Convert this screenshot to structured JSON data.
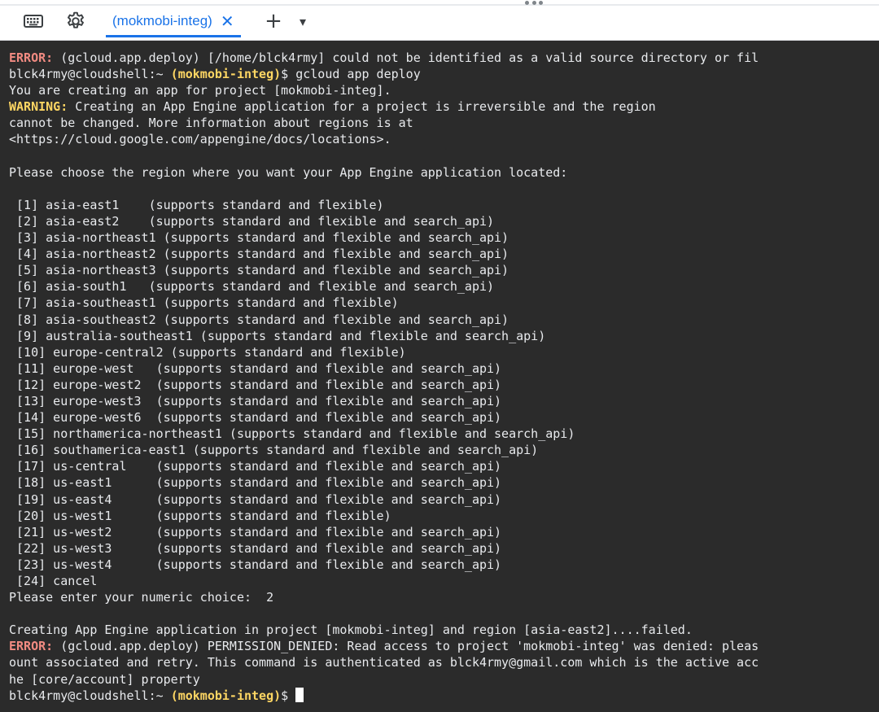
{
  "toolbar": {
    "keyboard_icon": "keyboard-icon",
    "settings_icon": "gear-icon",
    "tab_label": "(mokmobi-integ)",
    "tab_close": "✕",
    "add_tab": "+",
    "more": "▾"
  },
  "colors": {
    "error": "#f28b82",
    "warning": "#fdd663",
    "accent": "#1a73e8",
    "terminal_bg": "#2b2b2b",
    "terminal_fg": "#e8eaed"
  },
  "terminal": {
    "lines": [
      [
        {
          "t": "ERROR:",
          "c": "err"
        },
        {
          "t": " (gcloud.app.deploy) [/home/blck4rmy] could not be identified as a valid source directory or fil"
        }
      ],
      [
        {
          "t": "blck4rmy@cloudshell:~ "
        },
        {
          "t": "(mokmobi-integ)",
          "c": "proj"
        },
        {
          "t": "$ gcloud app deploy"
        }
      ],
      [
        {
          "t": "You are creating an app for project [mokmobi-integ]."
        }
      ],
      [
        {
          "t": "WARNING:",
          "c": "warn"
        },
        {
          "t": " Creating an App Engine application for a project is irreversible and the region"
        }
      ],
      [
        {
          "t": "cannot be changed. More information about regions is at"
        }
      ],
      [
        {
          "t": "<https://cloud.google.com/appengine/docs/locations>."
        }
      ],
      [
        {
          "t": ""
        }
      ],
      [
        {
          "t": "Please choose the region where you want your App Engine application located:"
        }
      ],
      [
        {
          "t": ""
        }
      ],
      [
        {
          "t": " [1] asia-east1    (supports standard and flexible)"
        }
      ],
      [
        {
          "t": " [2] asia-east2    (supports standard and flexible and search_api)"
        }
      ],
      [
        {
          "t": " [3] asia-northeast1 (supports standard and flexible and search_api)"
        }
      ],
      [
        {
          "t": " [4] asia-northeast2 (supports standard and flexible and search_api)"
        }
      ],
      [
        {
          "t": " [5] asia-northeast3 (supports standard and flexible and search_api)"
        }
      ],
      [
        {
          "t": " [6] asia-south1   (supports standard and flexible and search_api)"
        }
      ],
      [
        {
          "t": " [7] asia-southeast1 (supports standard and flexible)"
        }
      ],
      [
        {
          "t": " [8] asia-southeast2 (supports standard and flexible and search_api)"
        }
      ],
      [
        {
          "t": " [9] australia-southeast1 (supports standard and flexible and search_api)"
        }
      ],
      [
        {
          "t": " [10] europe-central2 (supports standard and flexible)"
        }
      ],
      [
        {
          "t": " [11] europe-west   (supports standard and flexible and search_api)"
        }
      ],
      [
        {
          "t": " [12] europe-west2  (supports standard and flexible and search_api)"
        }
      ],
      [
        {
          "t": " [13] europe-west3  (supports standard and flexible and search_api)"
        }
      ],
      [
        {
          "t": " [14] europe-west6  (supports standard and flexible and search_api)"
        }
      ],
      [
        {
          "t": " [15] northamerica-northeast1 (supports standard and flexible and search_api)"
        }
      ],
      [
        {
          "t": " [16] southamerica-east1 (supports standard and flexible and search_api)"
        }
      ],
      [
        {
          "t": " [17] us-central    (supports standard and flexible and search_api)"
        }
      ],
      [
        {
          "t": " [18] us-east1      (supports standard and flexible and search_api)"
        }
      ],
      [
        {
          "t": " [19] us-east4      (supports standard and flexible and search_api)"
        }
      ],
      [
        {
          "t": " [20] us-west1      (supports standard and flexible)"
        }
      ],
      [
        {
          "t": " [21] us-west2      (supports standard and flexible and search_api)"
        }
      ],
      [
        {
          "t": " [22] us-west3      (supports standard and flexible and search_api)"
        }
      ],
      [
        {
          "t": " [23] us-west4      (supports standard and flexible and search_api)"
        }
      ],
      [
        {
          "t": " [24] cancel"
        }
      ],
      [
        {
          "t": "Please enter your numeric choice:  2"
        }
      ],
      [
        {
          "t": ""
        }
      ],
      [
        {
          "t": "Creating App Engine application in project [mokmobi-integ] and region [asia-east2]....failed."
        }
      ],
      [
        {
          "t": "ERROR:",
          "c": "err"
        },
        {
          "t": " (gcloud.app.deploy) PERMISSION_DENIED: Read access to project 'mokmobi-integ' was denied: pleas"
        }
      ],
      [
        {
          "t": "ount associated and retry. This command is authenticated as blck4rmy@gmail.com which is the active acc"
        }
      ],
      [
        {
          "t": "he [core/account] property"
        }
      ],
      [
        {
          "t": "blck4rmy@cloudshell:~ "
        },
        {
          "t": "(mokmobi-integ)",
          "c": "proj"
        },
        {
          "t": "$ "
        }
      ]
    ]
  }
}
